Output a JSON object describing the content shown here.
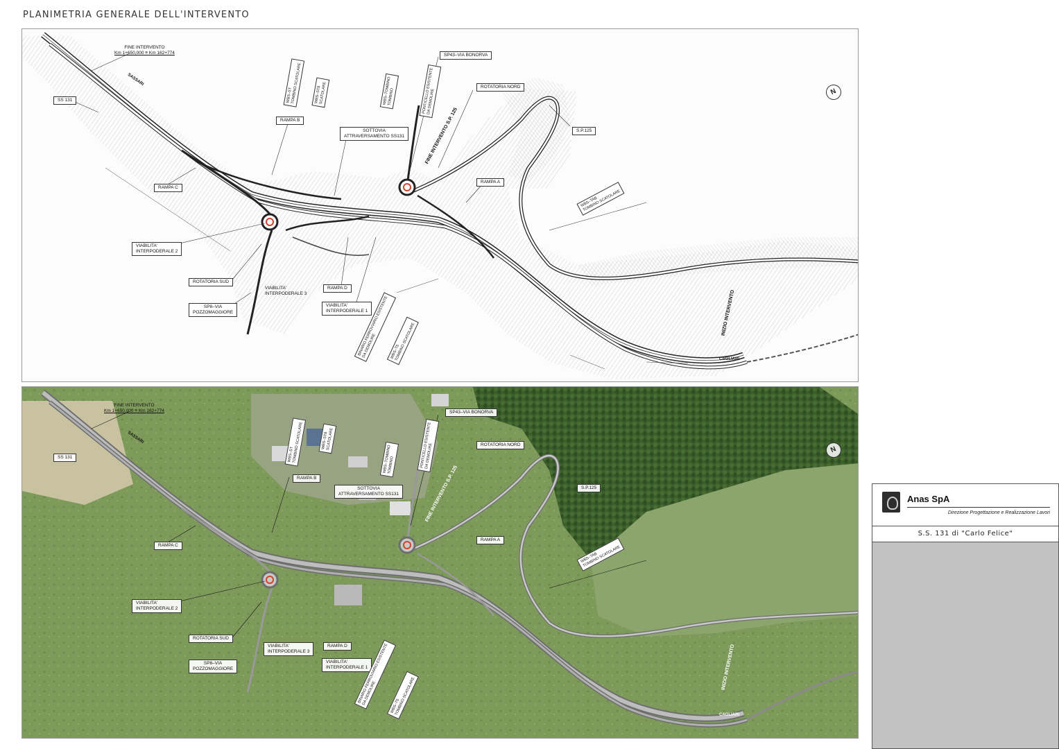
{
  "sheet_title": "PLANIMETRIA GENERALE DELL'INTERVENTO",
  "labels": {
    "fine_intervento_title": "FINE INTERVENTO",
    "fine_intervento_km": "Km 1+650,000 ≡ Km 162+774",
    "ss131": "SS 131",
    "sassari": "SASSARI",
    "cagliari": "CAGLIARI",
    "rampa_b": "RAMPA B",
    "rampa_c": "RAMPA C",
    "rampa_a": "RAMPA A",
    "rampa_d": "RAMPA D",
    "sottovia": "SOTTOVIA\nATTRAVERSAMENTO SS131",
    "sp43": "SP43–VIA BONORVA",
    "rotatoria_nord": "ROTATORIA NORD",
    "sp125": "S.P.125",
    "fine_intervento_sp125": "FINE INTERVENTO S.P. 125",
    "inizio_intervento": "INIZIO INTERVENTO",
    "viabilita_2": "VIABILITA'\nINTERPODERALE 2",
    "viabilita_3": "VIABILITA'\nINTERPODERALE 3",
    "viabilita_1": "VIABILITA'\nINTERPODERALE 1",
    "rotatoria_sud": "ROTATORIA SUD",
    "sp8": "SP8–VIA\nPOZZOMAGGIORE",
    "ponticello": "PONTICELLO ESISTENTE\nDA DEMOLIRE",
    "binario": "BINARIO FERROVIARIO ESISTENTE\nDA DEMOLIRE",
    "wbs_st": "WBS–ST\nTOMBINO SCATOLARE",
    "wbs_st8": "WBS–ST8\nSCATOLARE",
    "wbs_tombino": "WBS–TOMBINO\nTOMBINO",
    "wbs_tab": "WBS–TAB\nTOMBINO SCATOLARE",
    "wbs_t5": "WBS–T5\nTOMBINO SCATOLARE",
    "north": "N"
  },
  "title_block": {
    "company": "Anas SpA",
    "department": "Direzione Progettazione e Realizzazione Lavori",
    "road": "S.S. 131 di \"Carlo Felice\""
  },
  "colors": {
    "plan_background": "#fcfcfc",
    "road_line": "#222222",
    "terrain_hatch": "#9a9a9a",
    "roundabout": "#d0452a",
    "photo_grass": "#7d9a5b",
    "photo_forest": "#3b5e2b",
    "title_block_fill": "#c2c2c2"
  }
}
